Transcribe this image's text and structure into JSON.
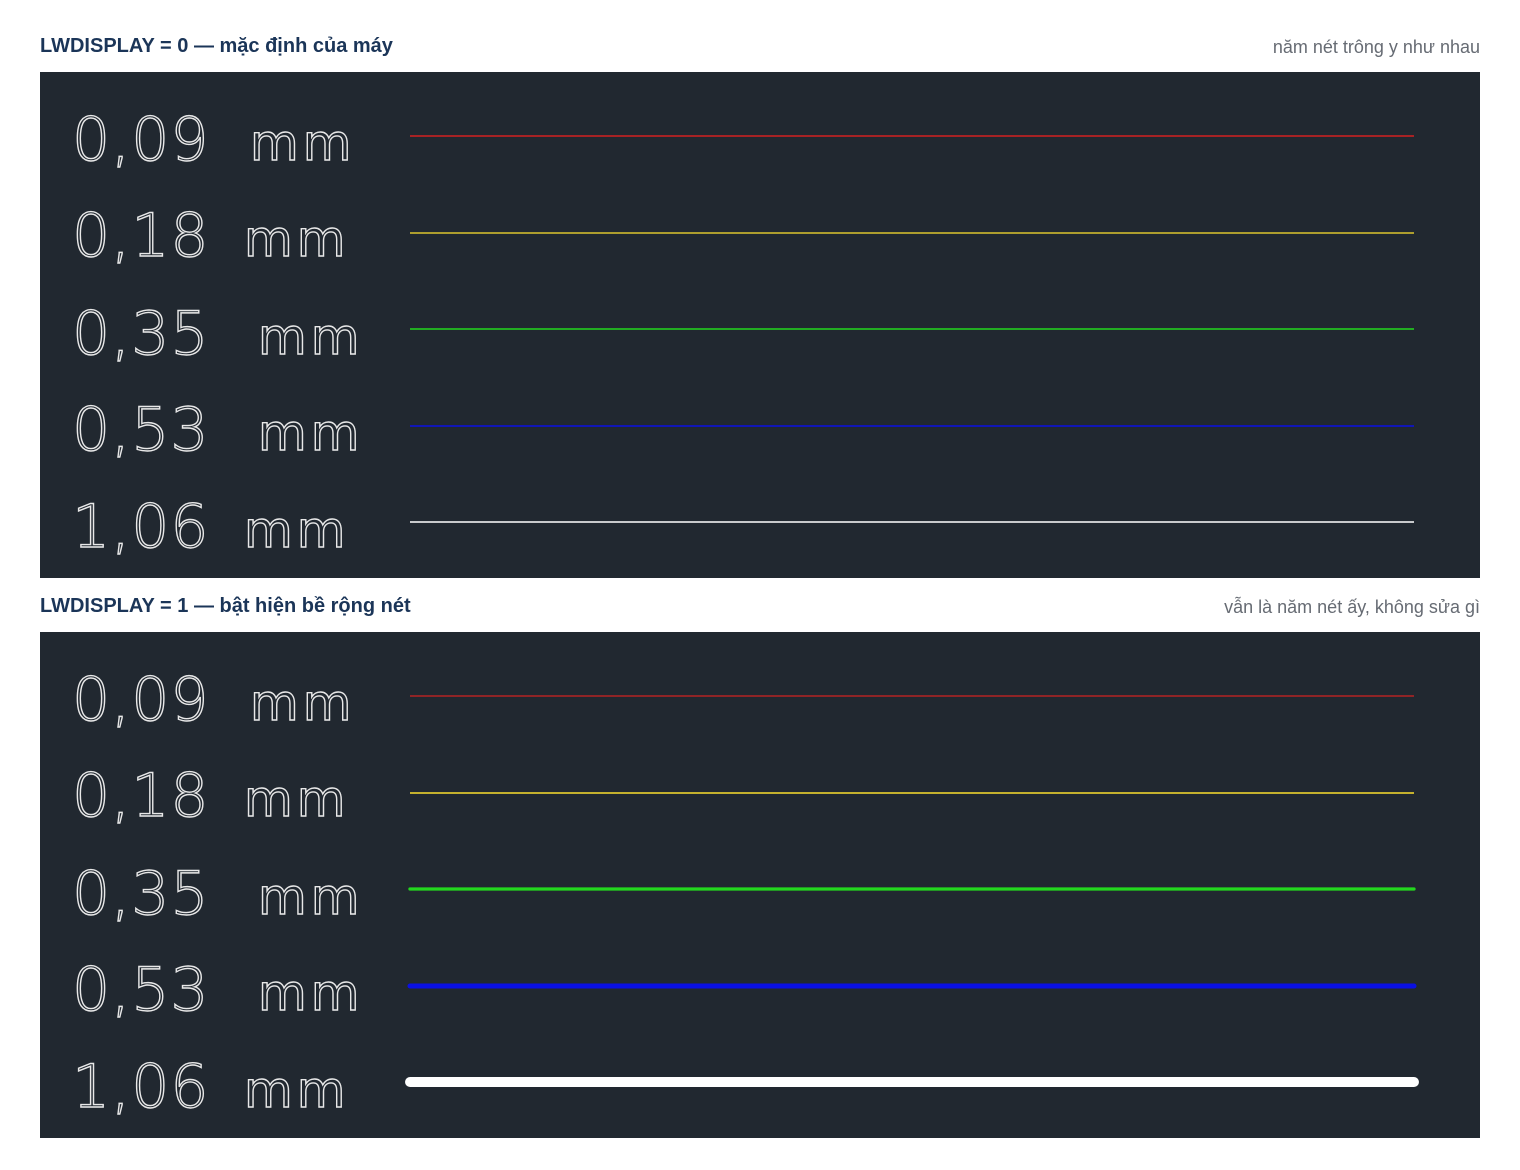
{
  "panels": [
    {
      "title": "LWDISPLAY = 0 — mặc định của máy",
      "note": "năm nét trông y như nhau",
      "lwdisplay": 0
    },
    {
      "title": "LWDISPLAY = 1 — bật hiện bề rộng nét",
      "note": "vẫn là năm nét ấy, không sửa gì",
      "lwdisplay": 1
    }
  ],
  "lines": [
    {
      "value": "0.09",
      "unit": "mm",
      "color": "#d42121",
      "weight_mm": 0.09
    },
    {
      "value": "0.18",
      "unit": "mm",
      "color": "#dcc52e",
      "weight_mm": 0.18
    },
    {
      "value": "0.35",
      "unit": "mm",
      "color": "#23d71e",
      "weight_mm": 0.35
    },
    {
      "value": "0.53",
      "unit": "mm",
      "color": "#0a10e3",
      "weight_mm": 0.53
    },
    {
      "value": "1.06",
      "unit": "mm",
      "color": "#ffffff",
      "weight_mm": 1.06
    }
  ],
  "panel_background": "#212830"
}
